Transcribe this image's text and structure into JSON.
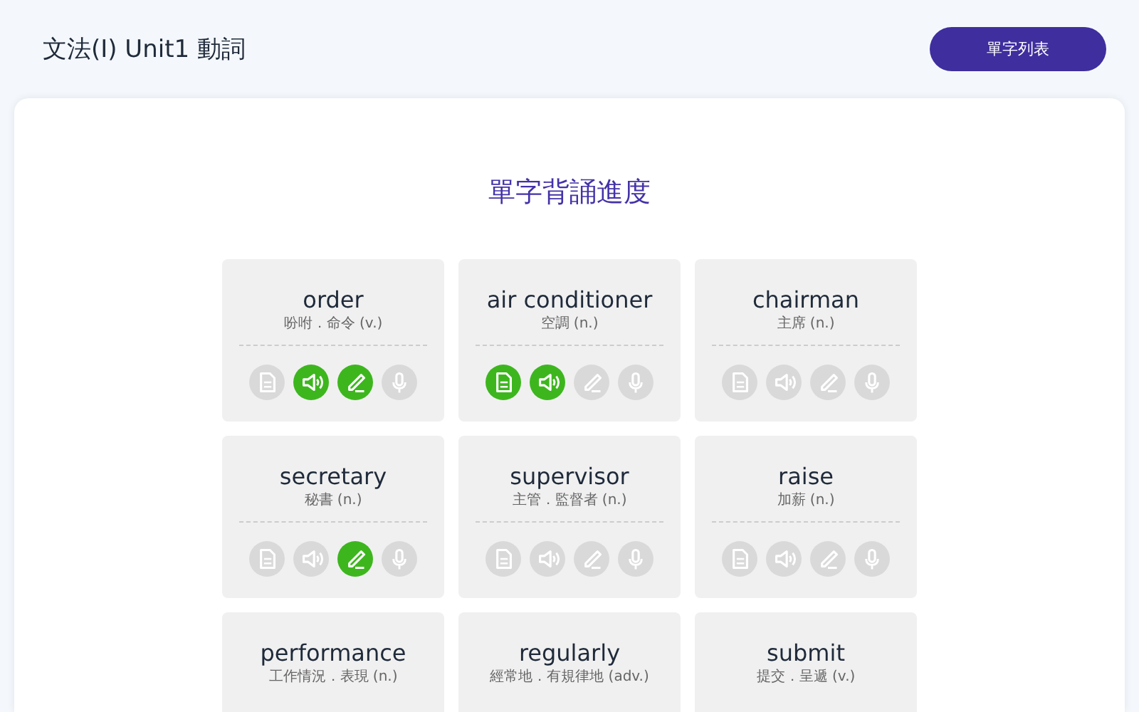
{
  "header": {
    "title": "文法(I) Unit1 動詞",
    "button": "單字列表"
  },
  "heading": "單字背誦進度",
  "words": [
    {
      "word": "order",
      "meaning": "吩咐．命令 (v.)",
      "steps": [
        {
          "kind": "read",
          "done": false
        },
        {
          "kind": "listen",
          "done": true
        },
        {
          "kind": "write",
          "done": true
        },
        {
          "kind": "speak",
          "done": false
        }
      ]
    },
    {
      "word": "air conditioner",
      "meaning": "空調 (n.)",
      "steps": [
        {
          "kind": "read",
          "done": true
        },
        {
          "kind": "listen",
          "done": true
        },
        {
          "kind": "write",
          "done": false
        },
        {
          "kind": "speak",
          "done": false
        }
      ]
    },
    {
      "word": "chairman",
      "meaning": "主席 (n.)",
      "steps": [
        {
          "kind": "read",
          "done": false
        },
        {
          "kind": "listen",
          "done": false
        },
        {
          "kind": "write",
          "done": false
        },
        {
          "kind": "speak",
          "done": false
        }
      ]
    },
    {
      "word": "secretary",
      "meaning": "秘書 (n.)",
      "steps": [
        {
          "kind": "read",
          "done": false
        },
        {
          "kind": "listen",
          "done": false
        },
        {
          "kind": "write",
          "done": true
        },
        {
          "kind": "speak",
          "done": false
        }
      ]
    },
    {
      "word": "supervisor",
      "meaning": "主管．監督者 (n.)",
      "steps": [
        {
          "kind": "read",
          "done": false
        },
        {
          "kind": "listen",
          "done": false
        },
        {
          "kind": "write",
          "done": false
        },
        {
          "kind": "speak",
          "done": false
        }
      ]
    },
    {
      "word": "raise",
      "meaning": "加薪 (n.)",
      "steps": [
        {
          "kind": "read",
          "done": false
        },
        {
          "kind": "listen",
          "done": false
        },
        {
          "kind": "write",
          "done": false
        },
        {
          "kind": "speak",
          "done": false
        }
      ]
    },
    {
      "word": "performance",
      "meaning": "工作情況．表現 (n.)"
    },
    {
      "word": "regularly",
      "meaning": "經常地．有規律地 (adv.)"
    },
    {
      "word": "submit",
      "meaning": "提交．呈遞 (v.)"
    }
  ]
}
